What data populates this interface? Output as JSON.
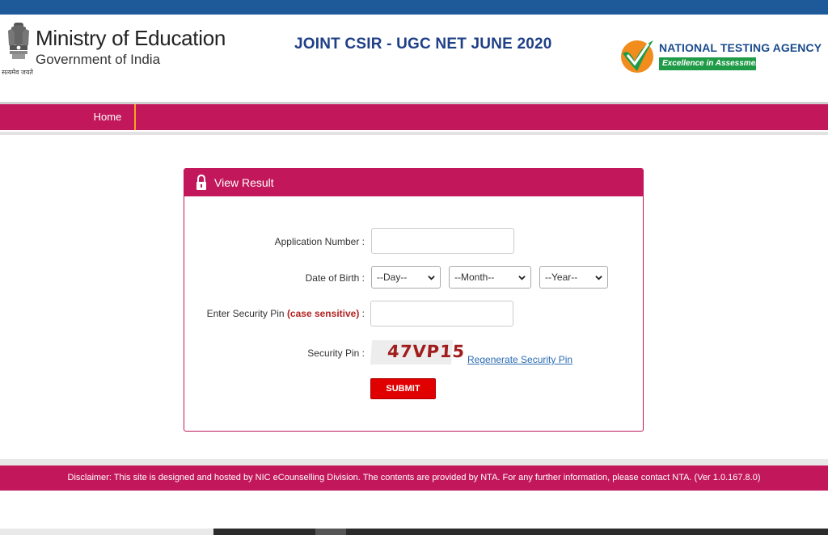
{
  "header": {
    "ministry_title": "Ministry of Education",
    "ministry_subtitle": "Government of India",
    "emblem_motto": "सत्यमेव जयते",
    "exam_title": "JOINT CSIR - UGC NET JUNE 2020",
    "agency_name": "NATIONAL TESTING AGENCY",
    "agency_tagline": "Excellence in Assessment"
  },
  "nav": {
    "items": [
      {
        "label": "Home"
      }
    ]
  },
  "form": {
    "title": "View Result",
    "application_number": {
      "label": "Application Number :",
      "value": "",
      "placeholder": ""
    },
    "dob": {
      "label": "Date of Birth :",
      "day": "--Day--",
      "month": "--Month--",
      "year": "--Year--"
    },
    "security_pin_input": {
      "label_prefix": "Enter Security Pin ",
      "label_emphasis": "(case sensitive)",
      "label_suffix": " :",
      "value": ""
    },
    "security_pin": {
      "label": "Security Pin :",
      "captcha": "47VP15"
    },
    "regenerate_label": "Regenerate Security Pin",
    "submit_label": "SUBMIT"
  },
  "footer": {
    "disclaimer": "Disclaimer: This site is designed and hosted by NIC eCounselling Division. The contents are provided by NTA. For any further information, please contact NTA. (Ver 1.0.167.8.0)"
  },
  "colors": {
    "brand_primary": "#c2185b",
    "top_strip": "#1e5a99",
    "title_blue": "#1f3f86",
    "nta_green": "#1f9b48",
    "submit_red": "#e00000",
    "link_blue": "#2a6ab1"
  }
}
